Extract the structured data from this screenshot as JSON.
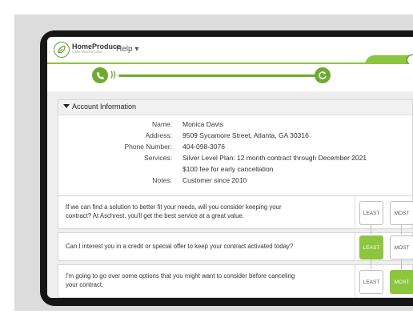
{
  "app": {
    "brand": "HomeProduce",
    "tagline": "CORE INNOVATIONS",
    "help_label": "Help ▾",
    "brand_color": "#8cc63f",
    "icons": [
      "leaf-logo-icon",
      "phone-icon",
      "sound-wave-icon",
      "refresh-icon"
    ]
  },
  "account": {
    "header": "Account Information",
    "fields": [
      {
        "label": "Name:",
        "value": "Monica Davis"
      },
      {
        "label": "Address:",
        "value": "9509 Sycamore Street, Atlanta, GA 30316"
      },
      {
        "label": "Phone Number:",
        "value": "404-098-3076"
      },
      {
        "label": "Services:",
        "value": "Silver Level Plan: 12 month contract through December 2021"
      },
      {
        "label": "",
        "value": "$100 fee for early cancellation"
      },
      {
        "label": "Notes:",
        "value": "Customer since 2010"
      }
    ]
  },
  "questions": [
    {
      "line1": "If we can find a solution to better fit your needs, will you consider keeping your",
      "line2": "contract? At Aschrest, you'll get the best service at a great value.",
      "least": "LEAST",
      "most": "MOST",
      "selected": "none"
    },
    {
      "line1": "Can I interest you in a credit or special offer to keep your contract activated today?",
      "line2": "",
      "least": "LEAST",
      "most": "MOST",
      "selected": "least"
    },
    {
      "line1": "I'm going to go over some options that you might want to consider before canceling",
      "line2": "your contract.",
      "least": "LEAST",
      "most": "MOST",
      "selected": "most"
    }
  ]
}
